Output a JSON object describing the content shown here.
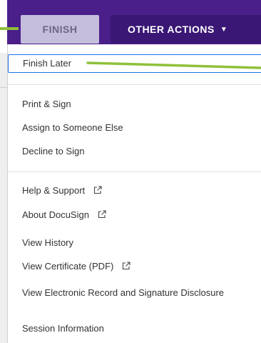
{
  "toolbar": {
    "finish_label": "FINISH",
    "other_actions_label": "OTHER ACTIONS",
    "caret_glyph": "▼"
  },
  "menu": {
    "items": [
      {
        "label": "Finish Later",
        "external": false
      },
      {
        "label": "Print & Sign",
        "external": false
      },
      {
        "label": "Assign to Someone Else",
        "external": false
      },
      {
        "label": "Decline to Sign",
        "external": false
      },
      {
        "label": "Help & Support",
        "external": true
      },
      {
        "label": "About DocuSign",
        "external": true
      },
      {
        "label": "View History",
        "external": false
      },
      {
        "label": "View Certificate (PDF)",
        "external": true
      },
      {
        "label": "View Electronic Record and Signature Disclosure",
        "external": false
      },
      {
        "label": "Session Information",
        "external": false
      }
    ]
  },
  "colors": {
    "topbar": "#4a1f89",
    "finish_button_bg": "#c4bedc",
    "other_actions_bg": "#3a1775",
    "highlight_border": "#1a73e8",
    "callout_green": "#8fc03a"
  },
  "icons": {
    "external_link": "external-link-icon",
    "caret": "chevron-down-icon"
  }
}
